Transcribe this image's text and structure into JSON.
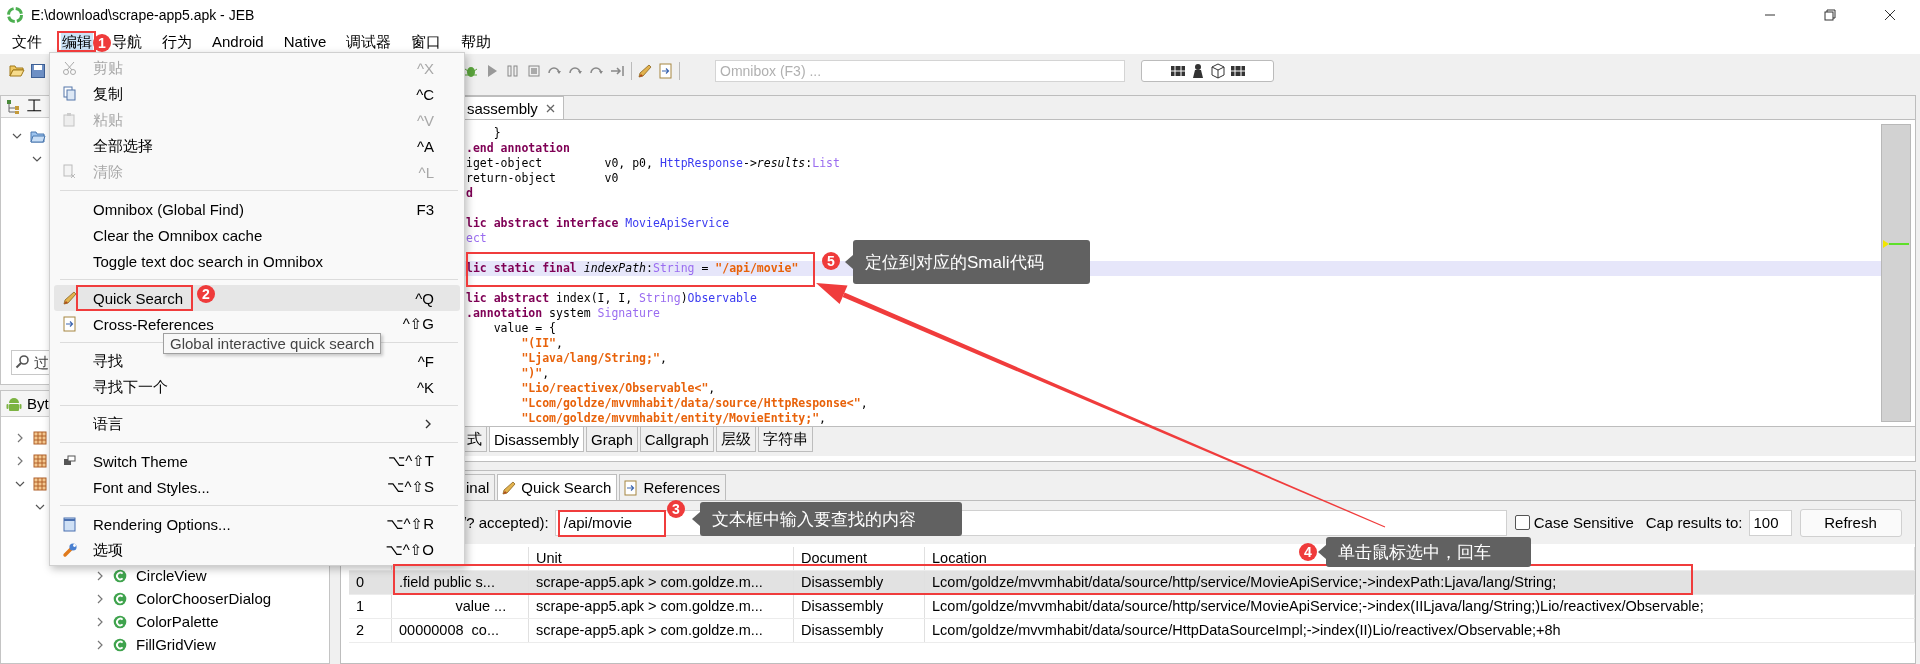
{
  "window": {
    "title": "E:\\download\\scrape-app5.apk - JEB"
  },
  "menubar": [
    {
      "label": "文件",
      "selected": false
    },
    {
      "label": "编辑",
      "selected": true
    },
    {
      "label": "导航",
      "selected": false
    },
    {
      "label": "行为",
      "selected": false
    },
    {
      "label": "Android",
      "selected": false
    },
    {
      "label": "Native",
      "selected": false
    },
    {
      "label": "调试器",
      "selected": false
    },
    {
      "label": "窗口",
      "selected": false
    },
    {
      "label": "帮助",
      "selected": false
    }
  ],
  "toolbar": {
    "omnibox": {
      "placeholder": "Omnibox (F3) ..."
    }
  },
  "project_panel": {
    "title": "工",
    "tree": [
      {
        "kind": "folder",
        "expanded": true,
        "children": [
          {
            "expanded": true
          }
        ]
      }
    ],
    "filter": {
      "placeholder": "过"
    }
  },
  "bytecode_panel": {
    "title": "Byt",
    "tree": [
      {
        "kind": "package",
        "expanded": false
      },
      {
        "kind": "package",
        "expanded": false
      },
      {
        "kind": "package",
        "expanded": true,
        "children": [
          {
            "expanded": true,
            "children": [
              {
                "children": [
                  {
                    "children": [
                      {
                        "kind": "class",
                        "label": "CircleView",
                        "expanded": false
                      },
                      {
                        "kind": "class",
                        "label": "ColorChooserDialog",
                        "expanded": false
                      },
                      {
                        "kind": "class",
                        "label": "ColorPalette",
                        "expanded": false
                      },
                      {
                        "kind": "class",
                        "label": "FillGridView",
                        "expanded": false
                      }
                    ]
                  }
                ]
              }
            ]
          }
        ]
      }
    ]
  },
  "editor": {
    "tab": {
      "label": "sassembly",
      "selected": true
    },
    "lines": [
      {
        "selected": false,
        "segments": [
          {
            "text": "    }",
            "kind": "plain"
          }
        ]
      },
      {
        "selected": false,
        "segments": [
          {
            "text": ".end annotation",
            "kind": "keyword"
          }
        ]
      },
      {
        "selected": false,
        "segments": [
          {
            "text": "iget-object         v0, p0, ",
            "kind": "plain"
          },
          {
            "text": "HttpResponse",
            "kind": "type"
          },
          {
            "text": "->",
            "kind": "plain"
          },
          {
            "text": "results",
            "kind": "field"
          },
          {
            "text": ":",
            "kind": "plain"
          },
          {
            "text": "List",
            "kind": "ref"
          }
        ]
      },
      {
        "selected": false,
        "segments": [
          {
            "text": "return-object       v0",
            "kind": "plain"
          }
        ]
      },
      {
        "selected": false,
        "segments": [
          {
            "text": "d",
            "kind": "keyword"
          }
        ]
      },
      {
        "selected": false
      },
      {
        "selected": false,
        "segments": [
          {
            "text": "lic abstract interface ",
            "kind": "keyword"
          },
          {
            "text": "MovieApiService",
            "kind": "type"
          }
        ]
      },
      {
        "selected": false,
        "segments": [
          {
            "text": "ect",
            "kind": "ref"
          }
        ]
      },
      {
        "selected": false
      },
      {
        "selected": true,
        "segments": [
          {
            "text": "lic static final ",
            "kind": "keyword"
          },
          {
            "text": "indexPath",
            "kind": "field"
          },
          {
            "text": ":",
            "kind": "plain"
          },
          {
            "text": "String",
            "kind": "ref"
          },
          {
            "text": " = ",
            "kind": "plain"
          },
          {
            "text": "\"/api/movie\"",
            "kind": "string"
          }
        ]
      },
      {
        "selected": false
      },
      {
        "selected": false,
        "segments": [
          {
            "text": "lic abstract",
            "kind": "keyword"
          },
          {
            "text": " index(I, I, ",
            "kind": "plain"
          },
          {
            "text": "String",
            "kind": "ref"
          },
          {
            "text": ")",
            "kind": "plain"
          },
          {
            "text": "Observable",
            "kind": "type"
          }
        ]
      },
      {
        "selected": false,
        "segments": [
          {
            "text": ".annotation",
            "kind": "keyword"
          },
          {
            "text": " system ",
            "kind": "plain"
          },
          {
            "text": "Signature",
            "kind": "ref"
          }
        ]
      },
      {
        "selected": false,
        "segments": [
          {
            "text": "    value = {",
            "kind": "plain"
          }
        ]
      },
      {
        "selected": false,
        "segments": [
          {
            "text": "        \"(II\"",
            "kind": "string"
          },
          {
            "text": ",",
            "kind": "plain"
          }
        ]
      },
      {
        "selected": false,
        "segments": [
          {
            "text": "        \"Ljava/lang/String;\"",
            "kind": "string"
          },
          {
            "text": ",",
            "kind": "plain"
          }
        ]
      },
      {
        "selected": false,
        "segments": [
          {
            "text": "        \")\"",
            "kind": "string"
          },
          {
            "text": ",",
            "kind": "plain"
          }
        ]
      },
      {
        "selected": false,
        "segments": [
          {
            "text": "        \"Lio/reactivex/Observable<\"",
            "kind": "string"
          },
          {
            "text": ",",
            "kind": "plain"
          }
        ]
      },
      {
        "selected": false,
        "segments": [
          {
            "text": "        \"Lcom/goldze/mvvmhabit/data/source/HttpResponse<\"",
            "kind": "string"
          },
          {
            "text": ",",
            "kind": "plain"
          }
        ]
      },
      {
        "selected": false,
        "segments": [
          {
            "text": "        \"Lcom/goldze/mvvmhabit/entity/MovieEntity;\"",
            "kind": "string"
          },
          {
            "text": ",",
            "kind": "plain"
          }
        ]
      }
    ],
    "bottom_tabs": [
      {
        "label": "式",
        "selected": false
      },
      {
        "label": "Disassembly",
        "selected": true
      },
      {
        "label": "Graph",
        "selected": false
      },
      {
        "label": "Callgraph",
        "selected": false
      },
      {
        "label": "层级",
        "selected": false
      },
      {
        "label": "字符串",
        "selected": false
      }
    ]
  },
  "results": {
    "tabs": [
      {
        "label": "inal",
        "selected": false,
        "kind": "plain"
      },
      {
        "label": "Quick Search",
        "selected": true,
        "kind": "search"
      },
      {
        "label": "References",
        "selected": false,
        "kind": "references"
      }
    ],
    "search": {
      "label": "/? accepted):",
      "value": "/api/movie"
    },
    "case_sensitive": {
      "label": "Case Sensitive",
      "checked": false
    },
    "cap": {
      "label": "Cap results to:",
      "value": "100"
    },
    "refresh": "Refresh",
    "table": {
      "columns": [
        "",
        "",
        "Unit",
        "Document",
        "Location"
      ],
      "rows": [
        {
          "selected": true,
          "cells": [
            "0",
            ".field public s...",
            "scrape-app5.apk > com.goldze.m...",
            "Disassembly",
            "Lcom/goldze/mvvmhabit/data/source/http/service/MovieApiService;->indexPath:Ljava/lang/String;"
          ]
        },
        {
          "selected": false,
          "cells": [
            "1",
            "              value ...",
            "scrape-app5.apk > com.goldze.m...",
            "Disassembly",
            "Lcom/goldze/mvvmhabit/data/source/http/service/MovieApiService;->index(IILjava/lang/String;)Lio/reactivex/Observable;"
          ]
        },
        {
          "selected": false,
          "cells": [
            "2",
            "00000008  co...",
            "scrape-app5.apk > com.goldze.m...",
            "Disassembly",
            "Lcom/goldze/mvvmhabit/data/source/HttpDataSourceImpl;->index(II)Lio/reactivex/Observable;+8h"
          ]
        }
      ]
    }
  },
  "edit_menu": {
    "items": [
      {
        "kind": "item",
        "label": "剪贴",
        "shortcut": "^X",
        "disabled": true,
        "selected": false
      },
      {
        "kind": "item",
        "label": "复制",
        "shortcut": "^C",
        "disabled": false,
        "selected": false
      },
      {
        "kind": "item",
        "label": "粘贴",
        "shortcut": "^V",
        "disabled": true,
        "selected": false
      },
      {
        "kind": "item",
        "label": "全部选择",
        "shortcut": "^A",
        "disabled": false,
        "selected": false
      },
      {
        "kind": "item",
        "label": "清除",
        "shortcut": "^L",
        "disabled": true,
        "selected": false
      },
      {
        "kind": "separator"
      },
      {
        "kind": "item",
        "label": "Omnibox (Global Find)",
        "shortcut": "F3",
        "disabled": false,
        "selected": false
      },
      {
        "kind": "item",
        "label": "Clear the Omnibox cache",
        "disabled": false,
        "selected": false
      },
      {
        "kind": "item",
        "label": "Toggle text doc search in Omnibox",
        "disabled": false,
        "selected": false
      },
      {
        "kind": "separator"
      },
      {
        "kind": "item",
        "label": "Quick Search",
        "shortcut": "^Q",
        "disabled": false,
        "selected": true
      },
      {
        "kind": "item",
        "label": "Cross-References",
        "shortcut": "^⇧G",
        "disabled": false,
        "selected": false
      },
      {
        "kind": "separator"
      },
      {
        "kind": "item",
        "label": "寻找",
        "shortcut": "^F",
        "disabled": false,
        "selected": false
      },
      {
        "kind": "item",
        "label": "寻找下一个",
        "shortcut": "^K",
        "disabled": false,
        "selected": false
      },
      {
        "kind": "separator"
      },
      {
        "kind": "submenu",
        "label": "语言",
        "disabled": false,
        "selected": false
      },
      {
        "kind": "separator"
      },
      {
        "kind": "item",
        "label": "Switch Theme",
        "shortcut": "⌥^⇧T",
        "disabled": false,
        "selected": false
      },
      {
        "kind": "item",
        "label": "Font and Styles...",
        "shortcut": "⌥^⇧S",
        "disabled": false,
        "selected": false
      },
      {
        "kind": "separator"
      },
      {
        "kind": "item",
        "label": "Rendering Options...",
        "shortcut": "⌥^⇧R",
        "disabled": false,
        "selected": false
      },
      {
        "kind": "item",
        "label": "选项",
        "shortcut": "⌥^⇧O",
        "disabled": false,
        "selected": false
      }
    ],
    "tooltip": "Global interactive quick search"
  },
  "annotations": [
    {
      "number": "1"
    },
    {
      "number": "2"
    },
    {
      "number": "3",
      "callout": "文本框中输入要查找的内容"
    },
    {
      "number": "4",
      "callout": "单击鼠标选中，回车"
    },
    {
      "number": "5",
      "callout": "定位到对应的Smali代码"
    }
  ]
}
